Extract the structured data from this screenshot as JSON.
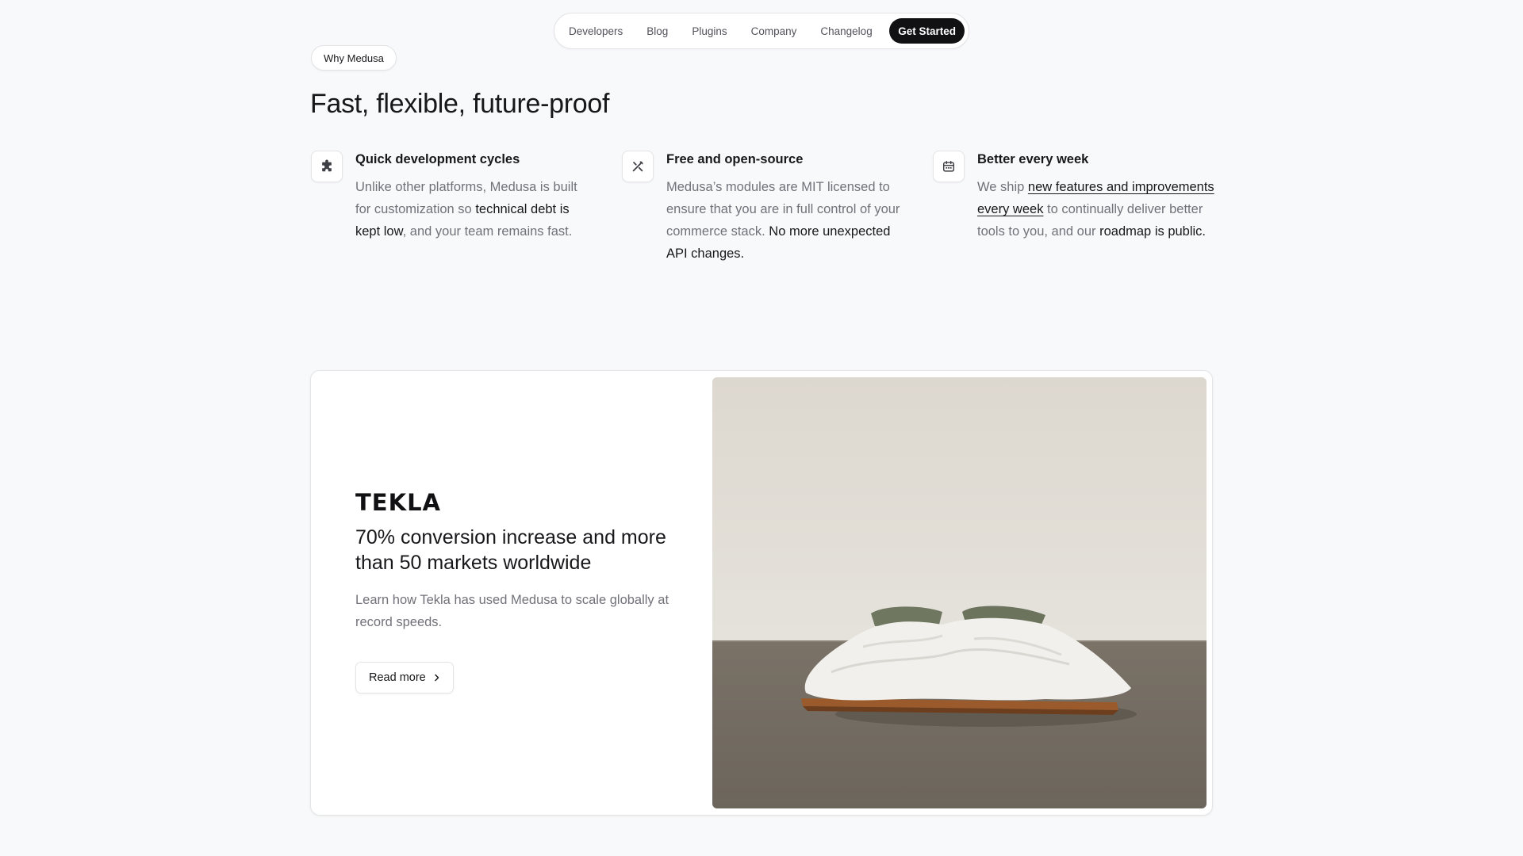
{
  "nav": {
    "links": [
      "Developers",
      "Blog",
      "Plugins",
      "Company",
      "Changelog"
    ],
    "cta_label": "Get Started"
  },
  "section": {
    "badge": "Why Medusa",
    "headline": "Fast, flexible, future-proof"
  },
  "features": [
    {
      "icon": "puzzle-icon",
      "title": "Quick development cycles",
      "body": {
        "t1": "Unlike other platforms, Medusa is built for customization so ",
        "h1": "technical debt is kept low",
        "t2": ", and your team remains fast."
      }
    },
    {
      "icon": "tools-icon",
      "title": "Free and open-source",
      "body": {
        "t1": "Medusa’s modules are MIT licensed to ensure that you are in full control of your commerce stack. ",
        "h1": "No more unexpected API changes."
      }
    },
    {
      "icon": "calendar-icon",
      "title": "Better every week",
      "body": {
        "t1": "We ship ",
        "link": "new features and improvements every week",
        "t2": " to continually deliver better tools to you, and our ",
        "h1": "roadmap is public."
      }
    }
  ],
  "case_study": {
    "logo": "TEKLA",
    "title": "70% conversion increase and more than 50 markets worldwide",
    "description": "Learn how Tekla has used Medusa to scale globally at record speeds.",
    "button_label": "Read more",
    "image": "bed-photo"
  }
}
